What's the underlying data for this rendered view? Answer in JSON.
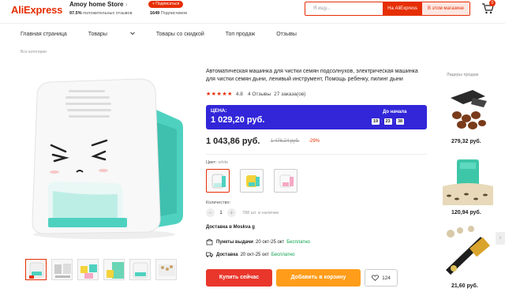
{
  "header": {
    "logo": "AliExpress",
    "store_name": "Amoy home Store",
    "store_caret": "›",
    "rating_pct": "97.5%",
    "rating_text": "положительных отзывов",
    "subscribe_label": "+ Подписаться",
    "subscribers_count": "1649",
    "subscribers_text": "Подписчиков",
    "search_placeholder": "Я ищу...",
    "search_ali_label": "На AliExpress",
    "search_store_label": "В этом магазине",
    "cart_count": "0"
  },
  "nav": {
    "items": [
      "Главная страница",
      "Товары",
      "Товары со скидкой",
      "Топ продаж",
      "Отзывы"
    ],
    "breadcrumb": "Все категории"
  },
  "product": {
    "title": "Автоматическая машинка для чистки семян подсолнухов, электрическая машинка для чистки семян дыни, ленивый инструмент, Помощь ребенку, пилинг дыни",
    "stars": "★★★★★",
    "rating": "4.8",
    "reviews": "4 Отзывы",
    "orders": "27 заказа(ов)",
    "price_label": "ЦЕНА:",
    "price": "1 029,20 руб.",
    "countdown_label": "До начала",
    "countdown": [
      "19",
      "23",
      "38"
    ],
    "final_price": "1 043,86 руб.",
    "old_price": "1 476,24 руб.",
    "discount": "-29%",
    "color_label": "Цвет:",
    "color_value": "white",
    "qty_label": "Количество:",
    "qty_minus": "−",
    "qty_value": "1",
    "qty_plus": "+",
    "qty_available": "788 шт. в наличии",
    "ship_to": "Доставка в Moskva g",
    "pickup_label": "Пункты выдачи",
    "pickup_dates": "20 окт-25 окт",
    "pickup_free": "Бесплатно",
    "delivery_label": "Доставка",
    "delivery_dates": "20 окт-25 окт",
    "delivery_free": "Бесплатно",
    "buy_now": "Купить сейчас",
    "add_to_cart": "Добавить в корзину",
    "wishlist_count": "124"
  },
  "top_sellers": {
    "label": "Лидеры продаж",
    "items": [
      {
        "price": "279,32 руб."
      },
      {
        "price": "120,94 руб."
      },
      {
        "price": "21,60 руб."
      }
    ]
  },
  "colors": {
    "brand": "#e62e04",
    "banner": "#3226d8",
    "teal": "#4fd1c0",
    "buy": "#e9372c",
    "cart": "#ff9d1b"
  }
}
